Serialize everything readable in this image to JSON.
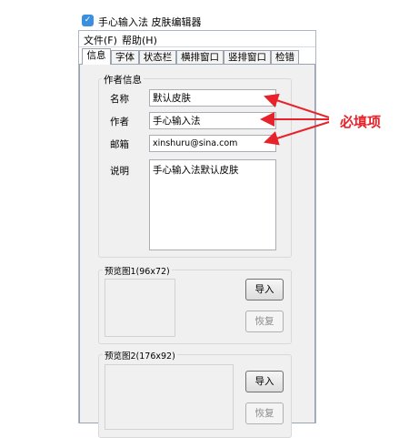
{
  "window": {
    "title": "手心输入法 皮肤编辑器",
    "icon": "app-check-icon"
  },
  "menu": [
    {
      "label": "文件(F)"
    },
    {
      "label": "帮助(H)"
    }
  ],
  "tabs": [
    {
      "label": "信息",
      "active": true
    },
    {
      "label": "字体"
    },
    {
      "label": "状态栏"
    },
    {
      "label": "横排窗口"
    },
    {
      "label": "竖排窗口"
    },
    {
      "label": "检错"
    }
  ],
  "author_group": {
    "title": "作者信息",
    "fields": [
      {
        "label": "名称",
        "value": "默认皮肤"
      },
      {
        "label": "作者",
        "value": "手心输入法"
      },
      {
        "label": "邮箱",
        "value": "xinshuru@sina.com"
      }
    ],
    "description": {
      "label": "说明",
      "value": "手心输入法默认皮肤"
    }
  },
  "preview1": {
    "title": "预览图1(96x72)",
    "import_label": "导入",
    "restore_label": "恢复"
  },
  "preview2": {
    "title": "预览图2(176x92)",
    "import_label": "导入",
    "restore_label": "恢复"
  },
  "annotation": {
    "text": "必填项",
    "color": "#e8222a"
  }
}
